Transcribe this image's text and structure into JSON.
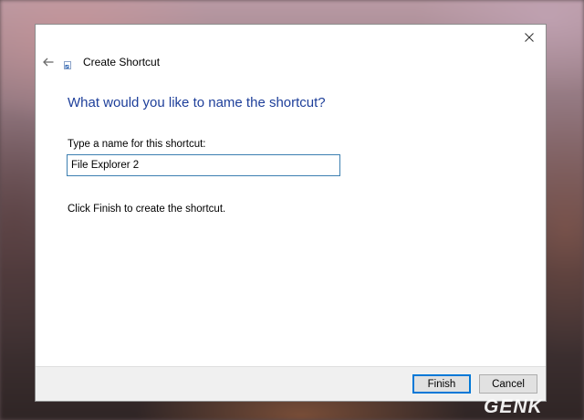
{
  "dialog": {
    "title": "Create Shortcut",
    "heading": "What would you like to name the shortcut?",
    "name_label": "Type a name for this shortcut:",
    "name_value": "File Explorer 2",
    "instruction": "Click Finish to create the shortcut.",
    "finish_label": "Finish",
    "cancel_label": "Cancel"
  },
  "icons": {
    "close": "close-icon",
    "back": "back-arrow-icon",
    "title": "shortcut-icon"
  },
  "watermark": {
    "text": "GENK"
  },
  "colors": {
    "heading": "#1e3f9a",
    "focus_border": "#0078d7",
    "watermark": "#ffffff"
  }
}
